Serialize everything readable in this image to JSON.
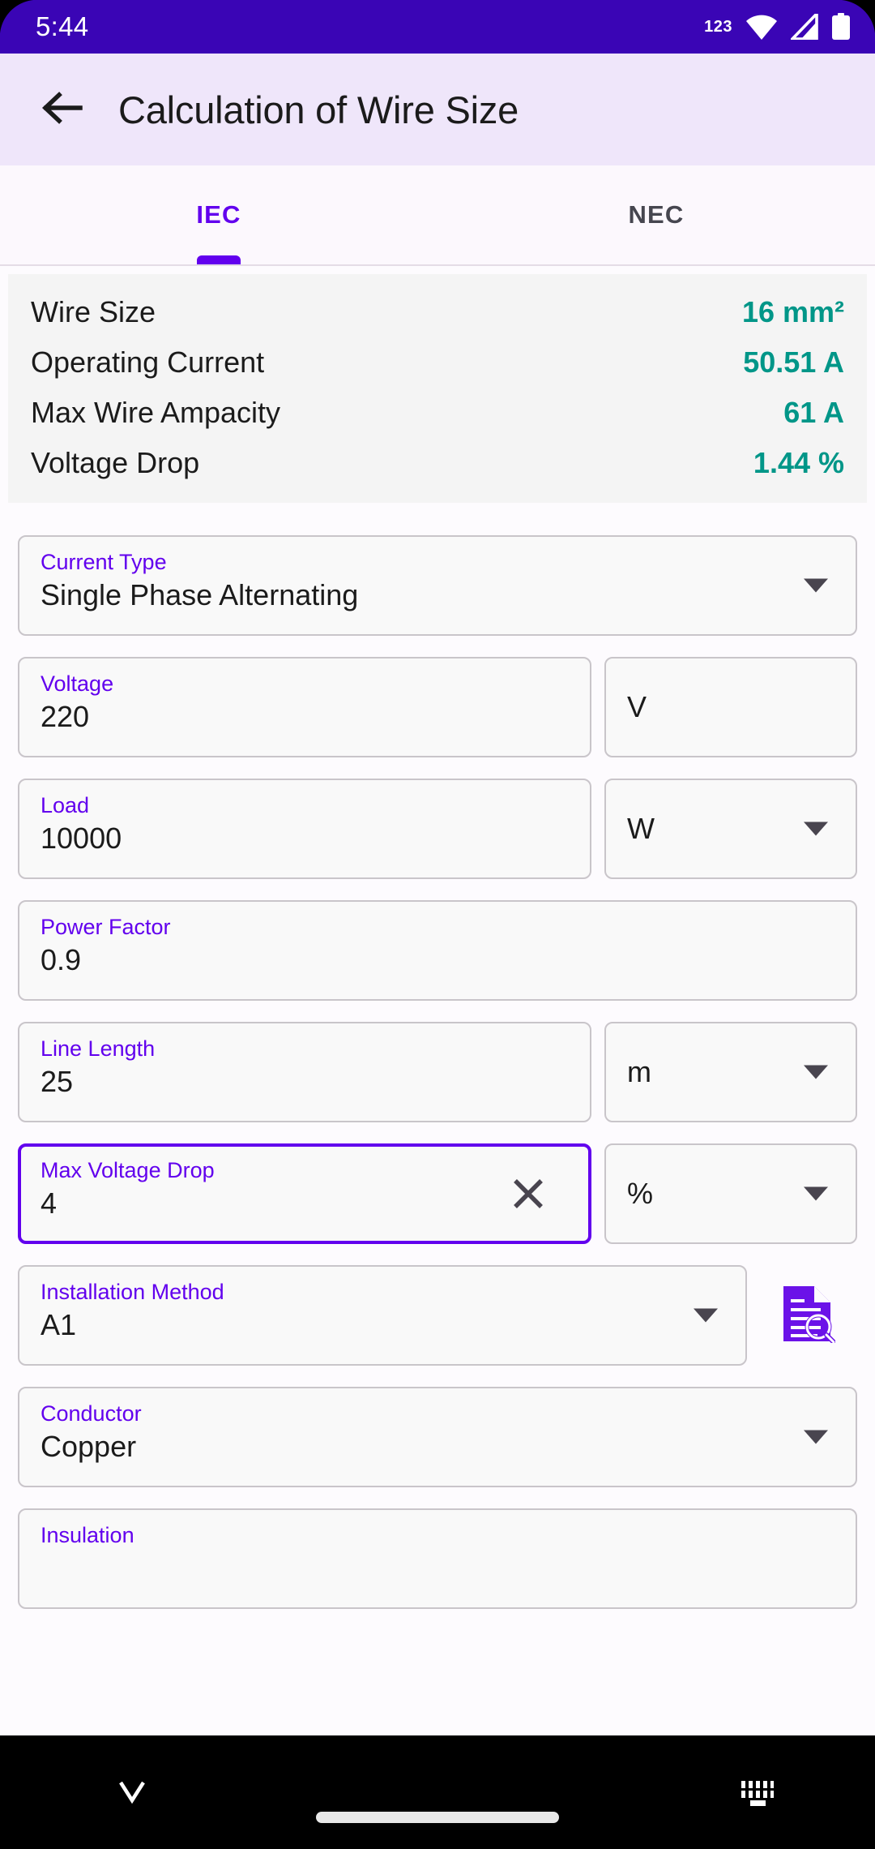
{
  "status_bar": {
    "time": "5:44",
    "notification_count": "123",
    "icons": [
      "wifi-icon",
      "cellular-signal-icon",
      "battery-icon"
    ],
    "background_color": "#3A05B5"
  },
  "app_bar": {
    "back_label": "back-arrow",
    "title": "Calculation of Wire Size",
    "background_color": "#EFE6FA"
  },
  "tabs": {
    "items": [
      {
        "label": "IEC",
        "active": true
      },
      {
        "label": "NEC",
        "active": false
      }
    ],
    "accent_color": "#6200EE"
  },
  "results": {
    "accent_color": "#009688",
    "rows": [
      {
        "label": "Wire Size",
        "value": "16 mm²"
      },
      {
        "label": "Operating Current",
        "value": "50.51 A"
      },
      {
        "label": "Max Wire Ampacity",
        "value": "61 A"
      },
      {
        "label": "Voltage Drop",
        "value": "1.44 %"
      }
    ]
  },
  "form": {
    "current_type": {
      "label": "Current Type",
      "value": "Single Phase Alternating"
    },
    "voltage": {
      "label": "Voltage",
      "value": "220"
    },
    "voltage_unit": {
      "value": "V"
    },
    "load": {
      "label": "Load",
      "value": "10000"
    },
    "load_unit": {
      "value": "W"
    },
    "power_factor": {
      "label": "Power Factor",
      "value": "0.9"
    },
    "line_length": {
      "label": "Line Length",
      "value": "25"
    },
    "line_length_unit": {
      "value": "m"
    },
    "max_voltage_drop": {
      "label": "Max Voltage Drop",
      "value": "4",
      "focused": true,
      "clear_icon": "close-icon"
    },
    "max_voltage_drop_unit": {
      "value": "%"
    },
    "installation_method": {
      "label": "Installation Method",
      "value": "A1"
    },
    "installation_info_icon": "document-search-icon",
    "conductor": {
      "label": "Conductor",
      "value": "Copper"
    },
    "insulation": {
      "label": "Insulation",
      "value": ""
    }
  },
  "nav_bar": {
    "items": [
      "chevron-down-icon",
      "home-indicator",
      "keyboard-switch-icon"
    ]
  }
}
